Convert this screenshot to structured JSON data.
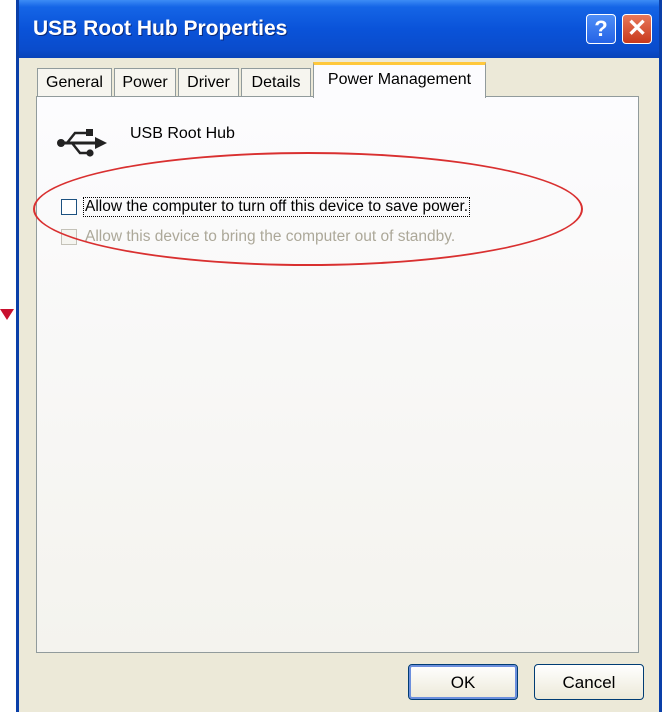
{
  "window": {
    "title": "USB Root Hub Properties",
    "help_glyph": "?",
    "close_glyph": "✕"
  },
  "tabs": [
    {
      "label": "General",
      "active": false
    },
    {
      "label": "Power",
      "active": false
    },
    {
      "label": "Driver",
      "active": false
    },
    {
      "label": "Details",
      "active": false
    },
    {
      "label": "Power Management",
      "active": true
    }
  ],
  "device": {
    "name": "USB Root Hub",
    "icon": "usb-trident-icon"
  },
  "options": [
    {
      "label": "Allow the computer to turn off this device to save power.",
      "checked": false,
      "enabled": true
    },
    {
      "label": "Allow this device to bring the computer out of standby.",
      "checked": false,
      "enabled": false
    }
  ],
  "buttons": {
    "ok": "OK",
    "cancel": "Cancel"
  },
  "colors": {
    "titlebar": "#0a53d9",
    "annotation": "#d93030",
    "active_tab_highlight": "#ffc83c"
  }
}
